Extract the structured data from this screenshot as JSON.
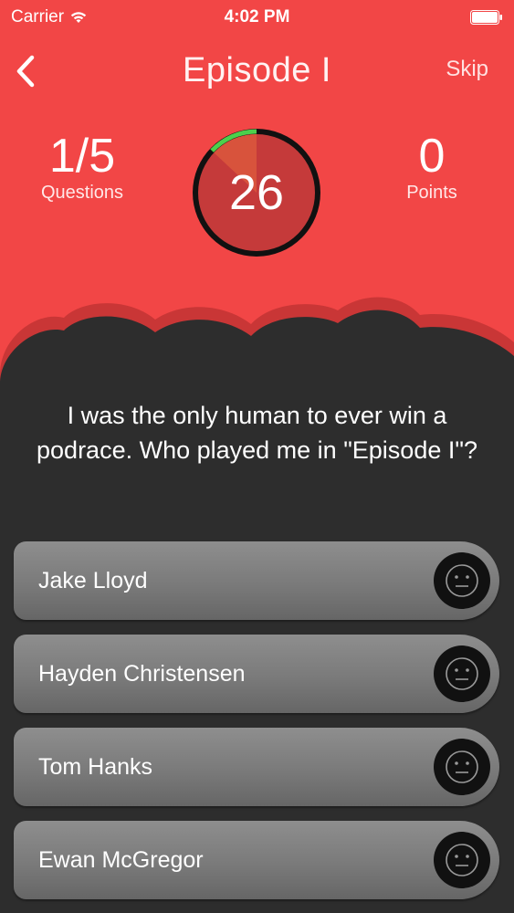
{
  "status_bar": {
    "carrier": "Carrier",
    "time": "4:02 PM"
  },
  "nav": {
    "title": "Episode I",
    "skip_label": "Skip"
  },
  "stats": {
    "questions_value": "1/5",
    "questions_label": "Questions",
    "points_value": "0",
    "points_label": "Points"
  },
  "timer": {
    "seconds": "26",
    "progress_elapsed_fraction": 0.13,
    "colors": {
      "ring": "#111111",
      "progress": "#4cd04c",
      "face": "#c53a3a",
      "wedge": "#d8533c"
    }
  },
  "question": {
    "text": "I was the only human to ever win a podrace. Who played me in \"Episode I\"?"
  },
  "answers": [
    {
      "label": "Jake Lloyd"
    },
    {
      "label": "Hayden Christensen"
    },
    {
      "label": "Tom Hanks"
    },
    {
      "label": "Ewan McGregor"
    }
  ],
  "icons": {
    "back": "chevron-left-icon",
    "answer": "neutral-face-icon",
    "wifi": "wifi-icon",
    "battery": "battery-icon"
  },
  "colors": {
    "header_red": "#f24646",
    "background_dark": "#2d2d2d",
    "answer_gray": "#7a7a7a"
  }
}
